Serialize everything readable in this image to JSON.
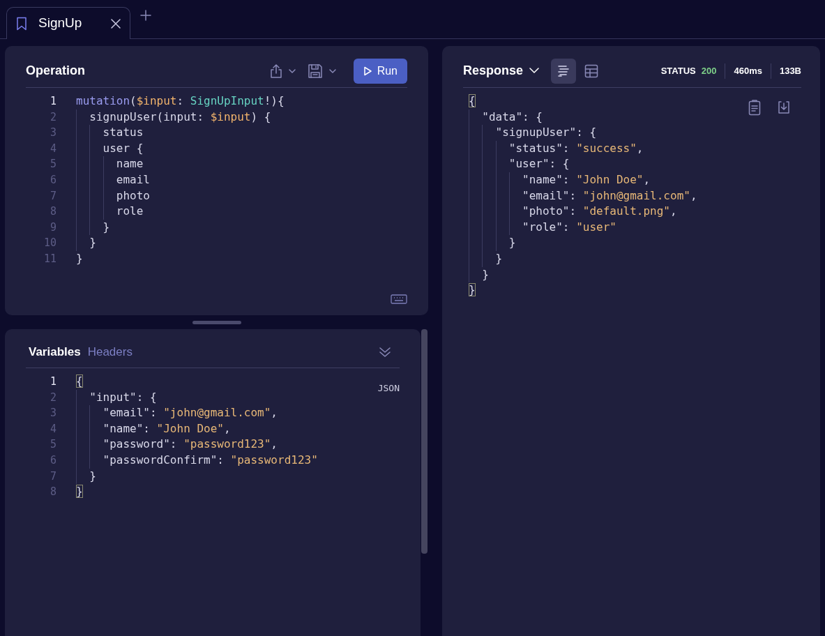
{
  "tabs": [
    {
      "label": "SignUp",
      "selected": true
    }
  ],
  "operation": {
    "title": "Operation",
    "run_label": "Run",
    "lines": [
      {
        "number": "1",
        "current": true,
        "tokens": [
          {
            "kind": "kw",
            "text": "mutation"
          },
          {
            "kind": "plain",
            "text": "("
          },
          {
            "kind": "var",
            "text": "$input"
          },
          {
            "kind": "plain",
            "text": ": "
          },
          {
            "kind": "type",
            "text": "SignUpInput"
          },
          {
            "kind": "plain",
            "text": "!){"
          }
        ],
        "children": [
          {
            "number": "2",
            "current": false,
            "tokens": [
              {
                "kind": "plain",
                "text": "signupUser(input: "
              },
              {
                "kind": "var",
                "text": "$input"
              },
              {
                "kind": "plain",
                "text": ") {"
              }
            ],
            "children": [
              {
                "number": "3",
                "current": false,
                "tokens": [
                  {
                    "kind": "plain",
                    "text": "status"
                  }
                ]
              },
              {
                "number": "4",
                "current": false,
                "tokens": [
                  {
                    "kind": "plain",
                    "text": "user {"
                  }
                ],
                "children": [
                  {
                    "number": "5",
                    "current": false,
                    "tokens": [
                      {
                        "kind": "plain",
                        "text": "name"
                      }
                    ]
                  },
                  {
                    "number": "6",
                    "current": false,
                    "tokens": [
                      {
                        "kind": "plain",
                        "text": "email"
                      }
                    ]
                  },
                  {
                    "number": "7",
                    "current": false,
                    "tokens": [
                      {
                        "kind": "plain",
                        "text": "photo"
                      }
                    ]
                  },
                  {
                    "number": "8",
                    "current": false,
                    "tokens": [
                      {
                        "kind": "plain",
                        "text": "role"
                      }
                    ]
                  }
                ]
              },
              {
                "number": "9",
                "current": false,
                "tokens": [
                  {
                    "kind": "plain",
                    "text": "}"
                  }
                ]
              }
            ]
          },
          {
            "number": "10",
            "current": false,
            "tokens": [
              {
                "kind": "plain",
                "text": "}"
              }
            ]
          }
        ]
      },
      {
        "number": "11",
        "current": false,
        "tokens": [
          {
            "kind": "plain",
            "text": "}"
          }
        ]
      }
    ]
  },
  "variables": {
    "tabs": [
      {
        "label": "Variables",
        "selected": true
      },
      {
        "label": "Headers",
        "selected": false
      }
    ],
    "language": "JSON",
    "lines": [
      {
        "number": "1",
        "current": true,
        "tokens": [
          {
            "kind": "match",
            "text": "{"
          }
        ],
        "children": [
          {
            "number": "2",
            "current": false,
            "tokens": [
              {
                "kind": "plain",
                "text": "\"input\": {"
              }
            ],
            "children": [
              {
                "number": "3",
                "current": false,
                "tokens": [
                  {
                    "kind": "plain",
                    "text": "\"email\": "
                  },
                  {
                    "kind": "string",
                    "text": "\"john@gmail.com\""
                  },
                  {
                    "kind": "plain",
                    "text": ","
                  }
                ]
              },
              {
                "number": "4",
                "current": false,
                "tokens": [
                  {
                    "kind": "plain",
                    "text": "\"name\": "
                  },
                  {
                    "kind": "string",
                    "text": "\"John Doe\""
                  },
                  {
                    "kind": "plain",
                    "text": ","
                  }
                ]
              },
              {
                "number": "5",
                "current": false,
                "tokens": [
                  {
                    "kind": "plain",
                    "text": "\"password\": "
                  },
                  {
                    "kind": "string",
                    "text": "\"password123\""
                  },
                  {
                    "kind": "plain",
                    "text": ","
                  }
                ]
              },
              {
                "number": "6",
                "current": false,
                "tokens": [
                  {
                    "kind": "plain",
                    "text": "\"passwordConfirm\": "
                  },
                  {
                    "kind": "string",
                    "text": "\"password123\""
                  }
                ]
              }
            ]
          },
          {
            "number": "7",
            "current": false,
            "tokens": [
              {
                "kind": "plain",
                "text": "}"
              }
            ]
          }
        ]
      },
      {
        "number": "8",
        "current": false,
        "tokens": [
          {
            "kind": "match",
            "text": "}"
          }
        ]
      }
    ]
  },
  "response": {
    "title": "Response",
    "views": [
      {
        "kind": "text",
        "selected": true
      },
      {
        "kind": "table",
        "selected": false
      }
    ],
    "status_label": "STATUS",
    "status_code": "200",
    "time": "460ms",
    "size": "133B",
    "lines": [
      {
        "tokens": [
          {
            "kind": "match",
            "text": "{"
          }
        ],
        "children": [
          {
            "tokens": [
              {
                "kind": "plain",
                "text": "\"data\": {"
              }
            ],
            "children": [
              {
                "tokens": [
                  {
                    "kind": "plain",
                    "text": "\"signupUser\": {"
                  }
                ],
                "children": [
                  {
                    "tokens": [
                      {
                        "kind": "plain",
                        "text": "\"status\": "
                      },
                      {
                        "kind": "string",
                        "text": "\"success\""
                      },
                      {
                        "kind": "plain",
                        "text": ","
                      }
                    ]
                  },
                  {
                    "tokens": [
                      {
                        "kind": "plain",
                        "text": "\"user\": {"
                      }
                    ],
                    "children": [
                      {
                        "tokens": [
                          {
                            "kind": "plain",
                            "text": "\"name\": "
                          },
                          {
                            "kind": "string",
                            "text": "\"John Doe\""
                          },
                          {
                            "kind": "plain",
                            "text": ","
                          }
                        ]
                      },
                      {
                        "tokens": [
                          {
                            "kind": "plain",
                            "text": "\"email\": "
                          },
                          {
                            "kind": "string",
                            "text": "\"john@gmail.com\""
                          },
                          {
                            "kind": "plain",
                            "text": ","
                          }
                        ]
                      },
                      {
                        "tokens": [
                          {
                            "kind": "plain",
                            "text": "\"photo\": "
                          },
                          {
                            "kind": "string",
                            "text": "\"default.png\""
                          },
                          {
                            "kind": "plain",
                            "text": ","
                          }
                        ]
                      },
                      {
                        "tokens": [
                          {
                            "kind": "plain",
                            "text": "\"role\": "
                          },
                          {
                            "kind": "string",
                            "text": "\"user\""
                          }
                        ]
                      }
                    ]
                  },
                  {
                    "tokens": [
                      {
                        "kind": "plain",
                        "text": "}"
                      }
                    ]
                  }
                ]
              },
              {
                "tokens": [
                  {
                    "kind": "plain",
                    "text": "}"
                  }
                ]
              }
            ]
          },
          {
            "tokens": [
              {
                "kind": "plain",
                "text": "}"
              }
            ]
          }
        ]
      },
      {
        "tokens": [
          {
            "kind": "match",
            "text": "}"
          }
        ]
      }
    ]
  }
}
